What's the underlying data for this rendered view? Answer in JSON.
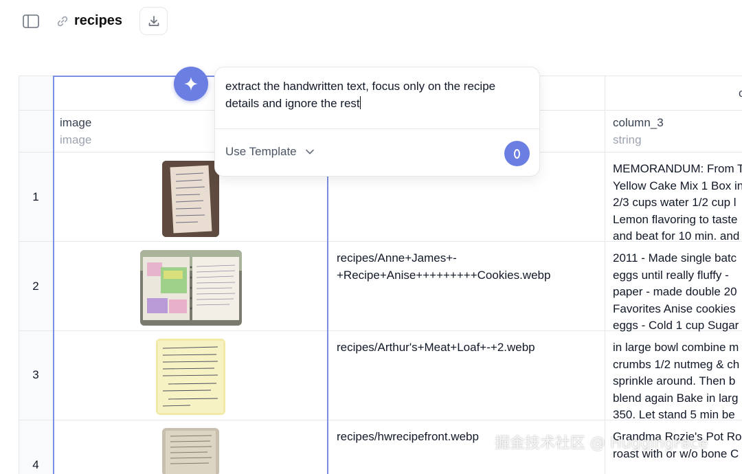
{
  "topbar": {
    "title": "recipes",
    "icons": {
      "sidebar_toggle": "sidebar-toggle-icon",
      "link": "link-icon",
      "download": "download-icon"
    }
  },
  "table": {
    "columns": [
      {
        "name": "image",
        "type": "image"
      },
      {
        "name": "",
        "type": ""
      },
      {
        "name": "column_3",
        "type": "string"
      }
    ],
    "column_4_header_partial": "c",
    "rows": [
      {
        "num": "1",
        "path": "",
        "text": [
          "MEMORANDUM: From T",
          "Yellow Cake Mix 1 Box in",
          "2/3 cups water 1/2 cup l",
          "Lemon flavoring to taste",
          "and beat for 10 min. and"
        ]
      },
      {
        "num": "2",
        "path": "recipes/Anne+James+-+Recipe+Anise+++++++++Cookies.webp",
        "path_lines": [
          "recipes/Anne+James+-",
          "+Recipe+Anise+++++++++Cookies.webp"
        ],
        "text": [
          "2011 - Made single batc",
          "eggs until really fluffy -",
          "paper - made double 20",
          "Favorites Anise cookies",
          "eggs - Cold 1 cup Sugar"
        ]
      },
      {
        "num": "3",
        "path": "recipes/Arthur's+Meat+Loaf+-+2.webp",
        "path_lines": [
          "recipes/Arthur's+Meat+Loaf+-+2.webp"
        ],
        "text": [
          "in large bowl combine m",
          "crumbs 1/2 nutmeg & ch",
          "sprinkle around. Then b",
          "blend again Bake in larg",
          "350. Let stand 5 min be"
        ]
      },
      {
        "num": "4",
        "path": "recipes/hwrecipefront.webp",
        "path_lines": [
          "recipes/hwrecipefront.webp"
        ],
        "text": [
          "Grandma Rozie's Pot Ro",
          "roast with or w/o bone C"
        ]
      }
    ]
  },
  "prompt_popup": {
    "text": "extract the handwritten text, focus only on the recipe details and ignore the rest",
    "use_template_label": "Use Template",
    "icons": {
      "ai": "sparkle-icon",
      "template_dropdown": "chevron-down-icon",
      "send": "send-icon"
    }
  },
  "watermark": "掘金技术社区 @ HuggingFace",
  "colors": {
    "accent": "#6b7fe3",
    "selected_border": "#7b8ee3",
    "grid": "#e5e7eb"
  }
}
